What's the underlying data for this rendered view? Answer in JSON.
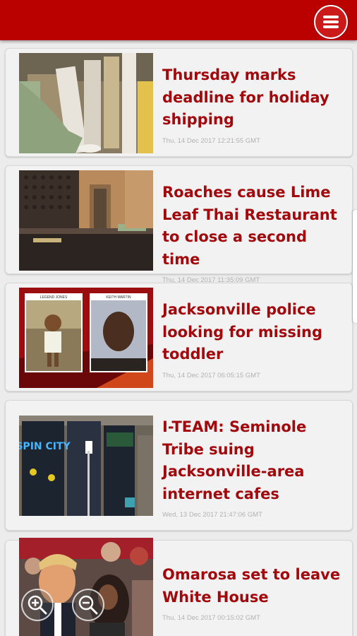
{
  "app": {
    "brand_color": "#bb0000",
    "headline_color": "#a3080c",
    "menu_icon": "hamburger-menu-icon"
  },
  "articles": [
    {
      "headline": "Thursday marks deadline for holiday shipping",
      "date": "Thu, 14 Dec 2017 12:21:55 GMT",
      "thumbnail": "packages-thumbnail"
    },
    {
      "headline": "Roaches cause Lime Leaf Thai Restaurant to close a second time",
      "date": "Thu, 14 Dec 2017 11:35:09 GMT",
      "thumbnail": "restaurant-thumbnail"
    },
    {
      "headline": "Jacksonville police looking for missing toddler",
      "date": "Thu, 14 Dec 2017 06:05:15 GMT",
      "thumbnail": "police-photos-thumbnail",
      "photo_labels": [
        "LEGEND JONES",
        "KEITH MARTIN"
      ]
    },
    {
      "headline": "I-TEAM: Seminole Tribe suing Jacksonville-area internet cafes",
      "date": "Wed, 13 Dec 2017 21:47:06 GMT",
      "thumbnail": "internet-cafe-thumbnail",
      "storefront_sign": "SPIN CITY"
    },
    {
      "headline": "Omarosa set to leave White House",
      "date": "Thu, 14 Dec 2017 00:15:02 GMT",
      "thumbnail": "crowd-thumbnail"
    }
  ],
  "zoom_controls": {
    "zoom_in_icon": "zoom-in-icon",
    "zoom_out_icon": "zoom-out-icon"
  }
}
